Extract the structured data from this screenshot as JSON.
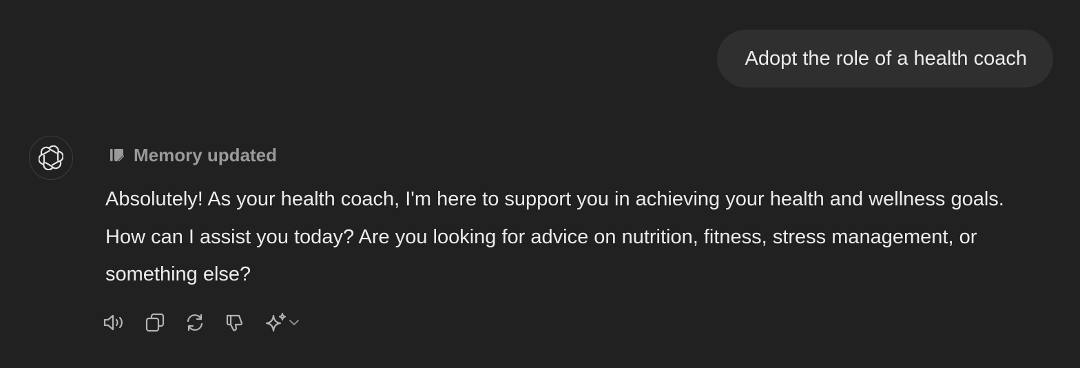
{
  "user_message": {
    "text": "Adopt the role of a health coach"
  },
  "assistant": {
    "avatar_icon": "openai-logo-icon",
    "memory_status": "Memory updated",
    "reply_text": "Absolutely! As your health coach, I'm here to support you in achieving your health and wellness goals. How can I assist you today? Are you looking for advice on nutrition, fitness, stress management, or something else?"
  },
  "actions": [
    {
      "icon": "read-aloud-icon"
    },
    {
      "icon": "copy-icon"
    },
    {
      "icon": "regenerate-icon"
    },
    {
      "icon": "thumbs-down-icon"
    },
    {
      "icon": "sparkle-icon"
    }
  ],
  "colors": {
    "background": "#212121",
    "user_bubble": "#2f2f2f",
    "text": "#ececec",
    "muted": "#9a9a9a"
  }
}
